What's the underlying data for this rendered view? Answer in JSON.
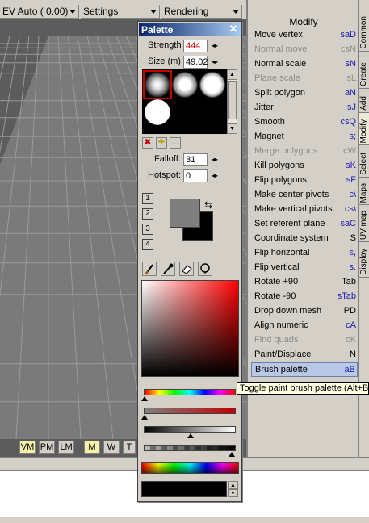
{
  "toolbar": {
    "ev_select": "EV Auto ( 0.00)",
    "settings_select": "Settings",
    "rendering_select": "Rendering"
  },
  "viewport": {
    "buttons": [
      "VM",
      "PM",
      "LM",
      "M",
      "W",
      "T"
    ]
  },
  "palette": {
    "title": "Palette",
    "strength_label": "Strength",
    "strength_value": "444",
    "size_label": "Size (m):",
    "size_value": "49.02",
    "falloff_label": "Falloff:",
    "falloff_value": "31",
    "hotspot_label": "Hotspot:",
    "hotspot_value": "0",
    "num_buttons": [
      "1",
      "2",
      "3",
      "4"
    ],
    "dots_button": "...",
    "swap_glyph": "⇆"
  },
  "modify_panel": {
    "title": "Modify",
    "items": [
      {
        "label": "Move vertex",
        "shortcut": "saD",
        "state": "normal"
      },
      {
        "label": "Normal move",
        "shortcut": "csN",
        "state": "disabled"
      },
      {
        "label": "Normal scale",
        "shortcut": "sN",
        "state": "normal"
      },
      {
        "label": "Plane scale",
        "shortcut": "sL",
        "state": "disabled"
      },
      {
        "label": "Split polygon",
        "shortcut": "aN",
        "state": "normal"
      },
      {
        "label": "Jitter",
        "shortcut": "sJ",
        "state": "normal"
      },
      {
        "label": "Smooth",
        "shortcut": "csQ",
        "state": "normal"
      },
      {
        "label": "Magnet",
        "shortcut": "s;",
        "state": "normal"
      },
      {
        "label": "Merge polygons",
        "shortcut": "cW",
        "state": "disabled"
      },
      {
        "label": "Kill polygons",
        "shortcut": "sK",
        "state": "normal"
      },
      {
        "label": "Flip polygons",
        "shortcut": "sF",
        "state": "normal"
      },
      {
        "label": "Make center pivots",
        "shortcut": "c\\",
        "state": "normal"
      },
      {
        "label": "Make vertical pivots",
        "shortcut": "cs\\",
        "state": "normal"
      },
      {
        "label": "Set referent plane",
        "shortcut": "saC",
        "state": "normal"
      },
      {
        "label": "Coordinate system",
        "shortcut": "S",
        "state": "normal",
        "plain": true
      },
      {
        "label": "Flip horizontal",
        "shortcut": "s,",
        "state": "normal"
      },
      {
        "label": "Flip vertical",
        "shortcut": "s.",
        "state": "normal"
      },
      {
        "label": "Rotate +90",
        "shortcut": "Tab",
        "state": "normal",
        "plain": true
      },
      {
        "label": "Rotate -90",
        "shortcut": "sTab",
        "state": "normal"
      },
      {
        "label": "Drop down mesh",
        "shortcut": "PD",
        "state": "normal",
        "plain": true
      },
      {
        "label": "Align numeric",
        "shortcut": "cA",
        "state": "normal"
      },
      {
        "label": "Find quads",
        "shortcut": "cK",
        "state": "disabled"
      },
      {
        "label": "Paint/Displace",
        "shortcut": "N",
        "state": "normal",
        "plain": true
      },
      {
        "label": "Brush palette",
        "shortcut": "aB",
        "state": "selected"
      }
    ]
  },
  "tabs": [
    "Common",
    "Create",
    "Add",
    "Modify",
    "Select",
    "Maps",
    "UV map",
    "Display"
  ],
  "tooltip": "Toggle paint brush palette (Alt+B)"
}
